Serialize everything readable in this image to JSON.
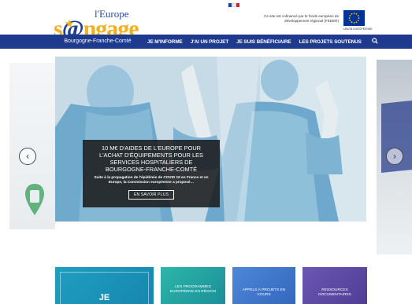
{
  "header": {
    "logo": {
      "line1": "l'Europe",
      "line2_pre": "s",
      "line2_o": "'",
      "line2_post": "ngage",
      "line3": "en"
    },
    "cofinancement_text": "Ce site est cofinancé par le fonds européen de développement régional (FEDER)",
    "eu_caption": "UNION EUROPÉENNE",
    "flag_colors": [
      "#1b3ea3",
      "#ffffff",
      "#d6202d"
    ]
  },
  "navbar": {
    "region_label": "Bourgogne-Franche-Comté",
    "items": [
      {
        "label": "JE M'INFORME"
      },
      {
        "label": "J'AI UN PROJET"
      },
      {
        "label": "JE SUIS BÉNÉFICIAIRE"
      },
      {
        "label": "LES PROJETS SOUTENUS"
      }
    ],
    "search_icon": "search-icon"
  },
  "carousel": {
    "prev_icon": "chevron-left-icon",
    "next_icon": "chevron-right-icon",
    "slide": {
      "title": "10 M€ d'aides de l'Europe pour l'achat d'équipements pour les services hospitaliers de Bourgogne-Franche-Comté",
      "body": "Suite à la propagation de l'épidémie de COVID 19 en France et en Europe, la Commission européenne a proposé…",
      "button_label": "EN SAVOIR PLUS"
    }
  },
  "tiles": [
    {
      "label": "JE",
      "color": "#1f9fc0"
    },
    {
      "label": "LES PROGRAMMES EUROPÉENS EN RÉGION",
      "color": "#2bb7a8"
    },
    {
      "label": "APPELS À PROJETS EN COURS",
      "color": "#4d87d8"
    },
    {
      "label": "RESSOURCES DOCUMENTAIRES",
      "color": "#6b57b4"
    }
  ],
  "colors": {
    "navbar": "#1e3a8e",
    "logo_yellow": "#f2b01e",
    "logo_blue": "#1f3f8f"
  }
}
